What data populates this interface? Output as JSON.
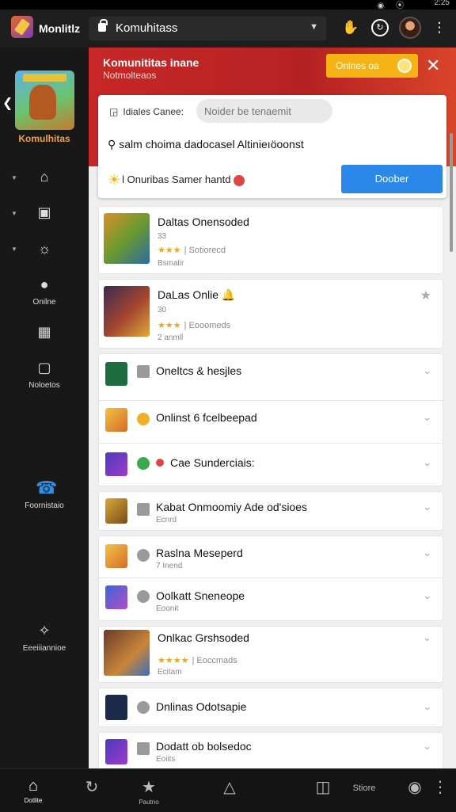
{
  "statusbar": {
    "time": "2:25",
    "icons": "◉ ⦿"
  },
  "app": {
    "name": "Monlitlz",
    "url": "Komuhitass"
  },
  "sidebar": {
    "game_title": "Komulhitas",
    "items": [
      {
        "label": "",
        "icon": "home-icon"
      },
      {
        "label": "",
        "icon": "open-box-icon"
      },
      {
        "label": "",
        "icon": "controller-icon"
      },
      {
        "label": "Onilne",
        "icon": "user-icon"
      },
      {
        "label": "",
        "icon": "chart-icon"
      },
      {
        "label": "Noloetos",
        "icon": "screen-icon"
      },
      {
        "label": "Foornistaio",
        "icon": "chat-icon"
      },
      {
        "label": "Eeeiiiannioe",
        "icon": "puzzle-icon"
      }
    ]
  },
  "hero": {
    "title": "Komunititas inane",
    "subtitle": "Notmolteaos",
    "online_pill": "Onlnes oa",
    "accent": "#c72727",
    "pill_color": "#f5b315"
  },
  "search": {
    "label": "Idiales Canee:",
    "placeholder": "Noider be tenaemit",
    "query": "salm choima dadocasel Altinieıöoonst",
    "hint": "l Onuribas Samer hantd",
    "button": "Doober",
    "button_color": "#2b87e8"
  },
  "list": [
    {
      "title": "Daltas Onensoded",
      "meta1": "33",
      "stars": "★★★",
      "rating": "| Sotiorecd",
      "meta2": "Bsmalir"
    },
    {
      "title": "DaLas Onlie 🔔",
      "meta1": "30",
      "stars": "★★★",
      "rating": "| Eooomeds",
      "meta2": "2 anmll"
    },
    {
      "title": "Oneltcs & hesjles",
      "meta": ""
    },
    {
      "title": "Onlinst 6 fcelbeepad",
      "meta": ""
    },
    {
      "title": "Cae Sunderciais:",
      "meta": ""
    },
    {
      "title": "Kabat Onmoomiy Ade od'sioes",
      "meta": "Ecnrd"
    },
    {
      "title": "Raslna Meseperd",
      "meta": "7 Inend"
    },
    {
      "title": "Oolkatt Sneneope",
      "meta": "Eoonit"
    },
    {
      "title": "Onlkac Grshsoded",
      "stars": "★★★★",
      "rating": "| Eoccmads",
      "meta": "Ecitam"
    },
    {
      "title": "Dnlinas Odotsapie",
      "meta": ""
    },
    {
      "title": "Dodatt ob bolsedoc",
      "meta": "Eoiits"
    }
  ],
  "bottombar": [
    {
      "label": "Dotlite",
      "icon": "home-icon"
    },
    {
      "label": "",
      "icon": "refresh-icon"
    },
    {
      "label": "Pautno",
      "icon": "star-icon"
    },
    {
      "label": "",
      "icon": "explore-icon"
    },
    {
      "label": "",
      "icon": "tablet-icon"
    },
    {
      "label": "Stiore",
      "icon": "store-text"
    },
    {
      "label": "",
      "icon": "profile-icon"
    }
  ]
}
